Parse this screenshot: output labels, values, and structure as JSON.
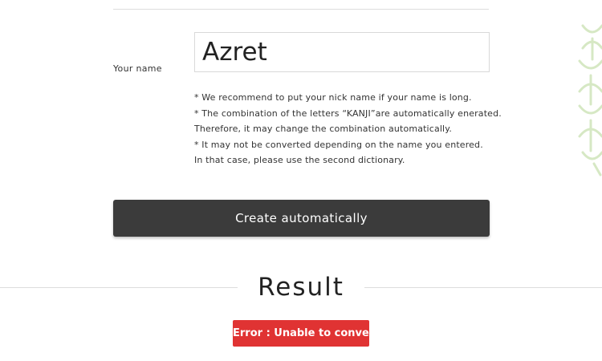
{
  "form": {
    "name_label": "Your name",
    "name_value": "Azret",
    "notes": [
      "* We recommend to put your nick name if your name is long.",
      "* The combination of the letters “KANJI”are automatically enerated.",
      "Therefore, it may change the combination automatically.",
      "* It may not be converted depending on the name you entered.",
      "In that case, please use the second dictionary."
    ],
    "create_button_label": "Create automatically"
  },
  "result": {
    "heading": "Result",
    "error_message": "Error : Unable to convert"
  },
  "colors": {
    "button_bg": "#3b3b3b",
    "error_bg": "#e03333",
    "decor_pattern": "#d6e8c4"
  },
  "icons": {
    "decor": "japanese-pattern-decoration"
  }
}
